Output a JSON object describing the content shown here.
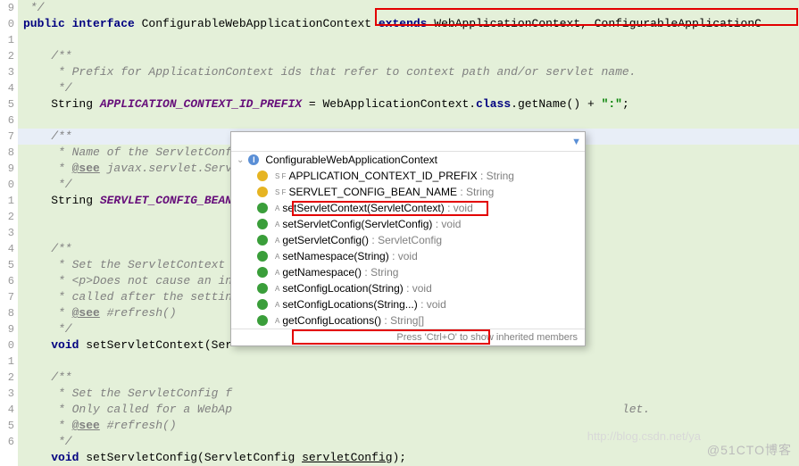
{
  "lineNumbers": [
    "9",
    "0",
    "1",
    "2",
    "3",
    "4",
    "5",
    "6",
    "7",
    "8",
    "9",
    "0",
    "1",
    "2",
    "3",
    "4",
    "5",
    "6",
    "7",
    "8",
    "9",
    "0",
    "1",
    "2",
    "3",
    "4",
    "5",
    "6"
  ],
  "code": {
    "l0": " */",
    "l1a": "public interface ",
    "l1b": "ConfigurableWebApplicationContext ",
    "l1c": "extends ",
    "l1d": "WebApplicationContext, ConfigurableApplicationC",
    "l3": "    /**",
    "l4": "     * Prefix for ApplicationContext ids that refer to context path and/or servlet name.",
    "l5": "     */",
    "l6a": "    String ",
    "l6b": "APPLICATION_CONTEXT_ID_PREFIX",
    "l6c": " = WebApplicationContext.",
    "l6d": "class",
    "l6e": ".getName() + ",
    "l6f": "\":\"",
    "l6g": ";",
    "l8": "    /**",
    "l9": "     * Name of the ServletConf",
    "l10a": "     * ",
    "l10b": "@see",
    "l10c": " javax.servlet.Serv",
    "l11": "     */",
    "l12a": "    String ",
    "l12b": "SERVLET_CONFIG_BEAN",
    "l15": "    /**",
    "l16": "     * Set the ServletContext ",
    "l17a": "     * <p>",
    "l17b": "Does not cause an in",
    "l18": "     * called after the settin",
    "l19a": "     * ",
    "l19b": "@see",
    "l19c": " #refresh()",
    "l20": "     */",
    "l21a": "    ",
    "l21b": "void",
    "l21c": " setServletContext(Ser",
    "l23": "    /**",
    "l24": "     * Set the ServletConfig f",
    "l25": "     * Only called for a WebAp",
    "l25b": "                                                        let.",
    "l26a": "     * ",
    "l26b": "@see",
    "l26c": " #refresh()",
    "l27": "     */",
    "l28a": "    ",
    "l28b": "void",
    "l28c": " setServletConfig(ServletConfig ",
    "l28d": "servletConfig",
    "l28e": ");"
  },
  "popup": {
    "root": "ConfigurableWebApplicationContext",
    "f1": {
      "n": "APPLICATION_CONTEXT_ID_PREFIX",
      "t": ": String"
    },
    "f2": {
      "n": "SERVLET_CONFIG_BEAN_NAME",
      "t": ": String"
    },
    "m1": {
      "n": "setServletContext(ServletContext)",
      "t": ": void"
    },
    "m2": {
      "n": "setServletConfig(ServletConfig)",
      "t": ": void"
    },
    "m3": {
      "n": "getServletConfig()",
      "t": ": ServletConfig"
    },
    "m4": {
      "n": "setNamespace(String)",
      "t": ": void"
    },
    "m5": {
      "n": "getNamespace()",
      "t": ": String"
    },
    "m6": {
      "n": "setConfigLocation(String)",
      "t": ": void"
    },
    "m7": {
      "n": "setConfigLocations(String...)",
      "t": ": void"
    },
    "m8": {
      "n": "getConfigLocations()",
      "t": ": String[]"
    },
    "footer": "Press 'Ctrl+O' to show inherited members"
  },
  "watermark": "@51CTO博客",
  "watermark2": "http://blog.csdn.net/ya"
}
